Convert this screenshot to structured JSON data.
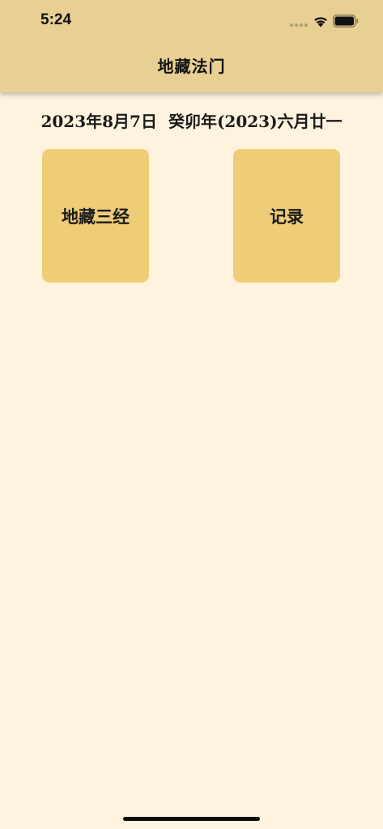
{
  "status_bar": {
    "time": "5:24"
  },
  "nav": {
    "title": "地藏法门"
  },
  "date": {
    "gregorian": "2023年8月7日",
    "lunar": "癸卯年(2023)六月廿一"
  },
  "tiles": [
    {
      "label": "地藏三经"
    },
    {
      "label": "记录"
    }
  ],
  "colors": {
    "header_bg": "#e8cf93",
    "page_bg": "#fdf3df",
    "tile_bg": "#efcd76"
  },
  "icons": {
    "wifi": "wifi-icon",
    "battery": "battery-icon",
    "cellular": "cellular-signal-icon"
  }
}
